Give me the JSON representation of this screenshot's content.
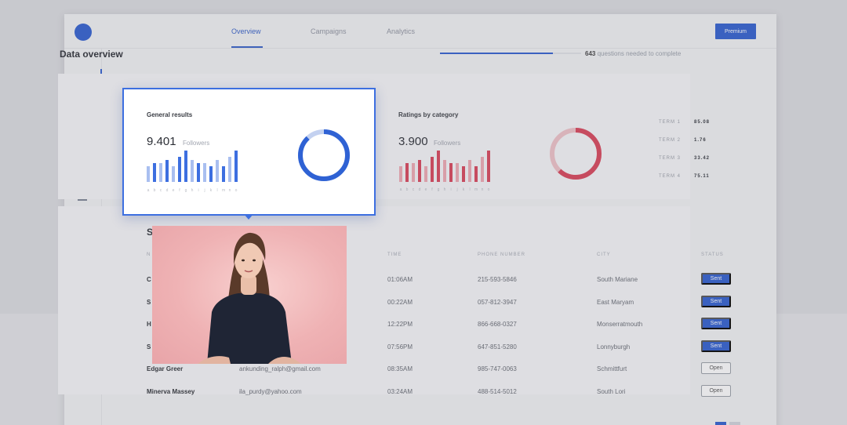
{
  "nav": {
    "tabs": [
      {
        "label": "Overview"
      },
      {
        "label": "Campaigns"
      },
      {
        "label": "Analytics"
      }
    ],
    "premium_label": "Premium"
  },
  "colors": {
    "accent": "#2f5fd0",
    "red": "#d9445a",
    "card_border": "#3d6fe0"
  },
  "sidebar": {
    "icons": [
      "dashboard-icon",
      "chat-icon",
      "folder-icon",
      "mail-icon",
      "gear-icon"
    ]
  },
  "header": {
    "title": "Data overview",
    "progress_count": "643",
    "progress_text": "questions needed to complete",
    "progress_fraction": 0.8
  },
  "general": {
    "title": "General results",
    "value": "9.401",
    "label": "Followers",
    "letters": [
      "a",
      "b",
      "c",
      "d",
      "e",
      "f",
      "g",
      "h",
      "i",
      "j",
      "k",
      "l",
      "m",
      "n",
      "o"
    ]
  },
  "ratings": {
    "title": "Ratings by category",
    "value": "3.900",
    "label": "Followers",
    "letters": [
      "a",
      "b",
      "c",
      "d",
      "e",
      "f",
      "g",
      "h",
      "i",
      "j",
      "k",
      "l",
      "m",
      "n",
      "o"
    ]
  },
  "terms": [
    {
      "label": "TERM 1",
      "value": "85.08"
    },
    {
      "label": "TERM 2",
      "value": "1.76"
    },
    {
      "label": "TERM 3",
      "value": "33.42"
    },
    {
      "label": "TERM 4",
      "value": "75.11"
    }
  ],
  "table": {
    "section_letter": "S",
    "columns": [
      "N",
      "TIME",
      "PHONE NUMBER",
      "CITY",
      "STATUS"
    ],
    "rows": [
      {
        "name": "C",
        "email": "",
        "time": "01:06AM",
        "phone": "215-593-5846",
        "city": "South Mariane",
        "status": "Sent"
      },
      {
        "name": "S",
        "email": "",
        "time": "00:22AM",
        "phone": "057-812-3947",
        "city": "East Maryam",
        "status": "Sent"
      },
      {
        "name": "H",
        "email": "",
        "time": "12:22PM",
        "phone": "866-668-0327",
        "city": "Monserratmouth",
        "status": "Sent"
      },
      {
        "name": "S",
        "email": "",
        "time": "07:56PM",
        "phone": "647-851-5280",
        "city": "Lonnyburgh",
        "status": "Sent"
      },
      {
        "name": "Edgar Greer",
        "email": "ankunding_ralph@gmail.com",
        "time": "08:35AM",
        "phone": "985-747-0063",
        "city": "Schmittfurt",
        "status": "Open"
      },
      {
        "name": "Minerva Massey",
        "email": "ila_purdy@yahoo.com",
        "time": "03:24AM",
        "phone": "488-514-5012",
        "city": "South Lori",
        "status": "Open"
      }
    ]
  },
  "chart_data": [
    {
      "type": "bar",
      "title": "General results",
      "categories": [
        "a",
        "b",
        "c",
        "d",
        "e",
        "f",
        "g",
        "h",
        "i",
        "j",
        "k",
        "l",
        "m",
        "n",
        "o"
      ],
      "series": [
        {
          "values": [
            5,
            6,
            6,
            7,
            5,
            8,
            10,
            7,
            6,
            6,
            5,
            7,
            5,
            8,
            10
          ]
        },
        {
          "values": [
            3,
            4,
            3,
            2,
            2,
            4,
            3,
            2,
            3,
            2,
            3,
            2,
            3,
            4,
            3
          ]
        }
      ]
    },
    {
      "type": "pie",
      "values": [
        88,
        12
      ],
      "colors": [
        "#2f62d4",
        "#c3d1f0"
      ]
    },
    {
      "type": "bar",
      "title": "Ratings by category",
      "categories": [
        "a",
        "b",
        "c",
        "d",
        "e",
        "f",
        "g",
        "h",
        "i",
        "j",
        "k",
        "l",
        "m",
        "n",
        "o"
      ],
      "series": [
        {
          "values": [
            5,
            6,
            6,
            7,
            5,
            8,
            10,
            7,
            6,
            6,
            5,
            7,
            5,
            8,
            10
          ]
        },
        {
          "values": [
            3,
            4,
            3,
            2,
            2,
            4,
            3,
            2,
            3,
            2,
            3,
            2,
            3,
            4,
            3
          ]
        }
      ]
    },
    {
      "type": "pie",
      "values": [
        62,
        38
      ],
      "colors": [
        "#d9445a",
        "#f0c2c8"
      ]
    }
  ]
}
